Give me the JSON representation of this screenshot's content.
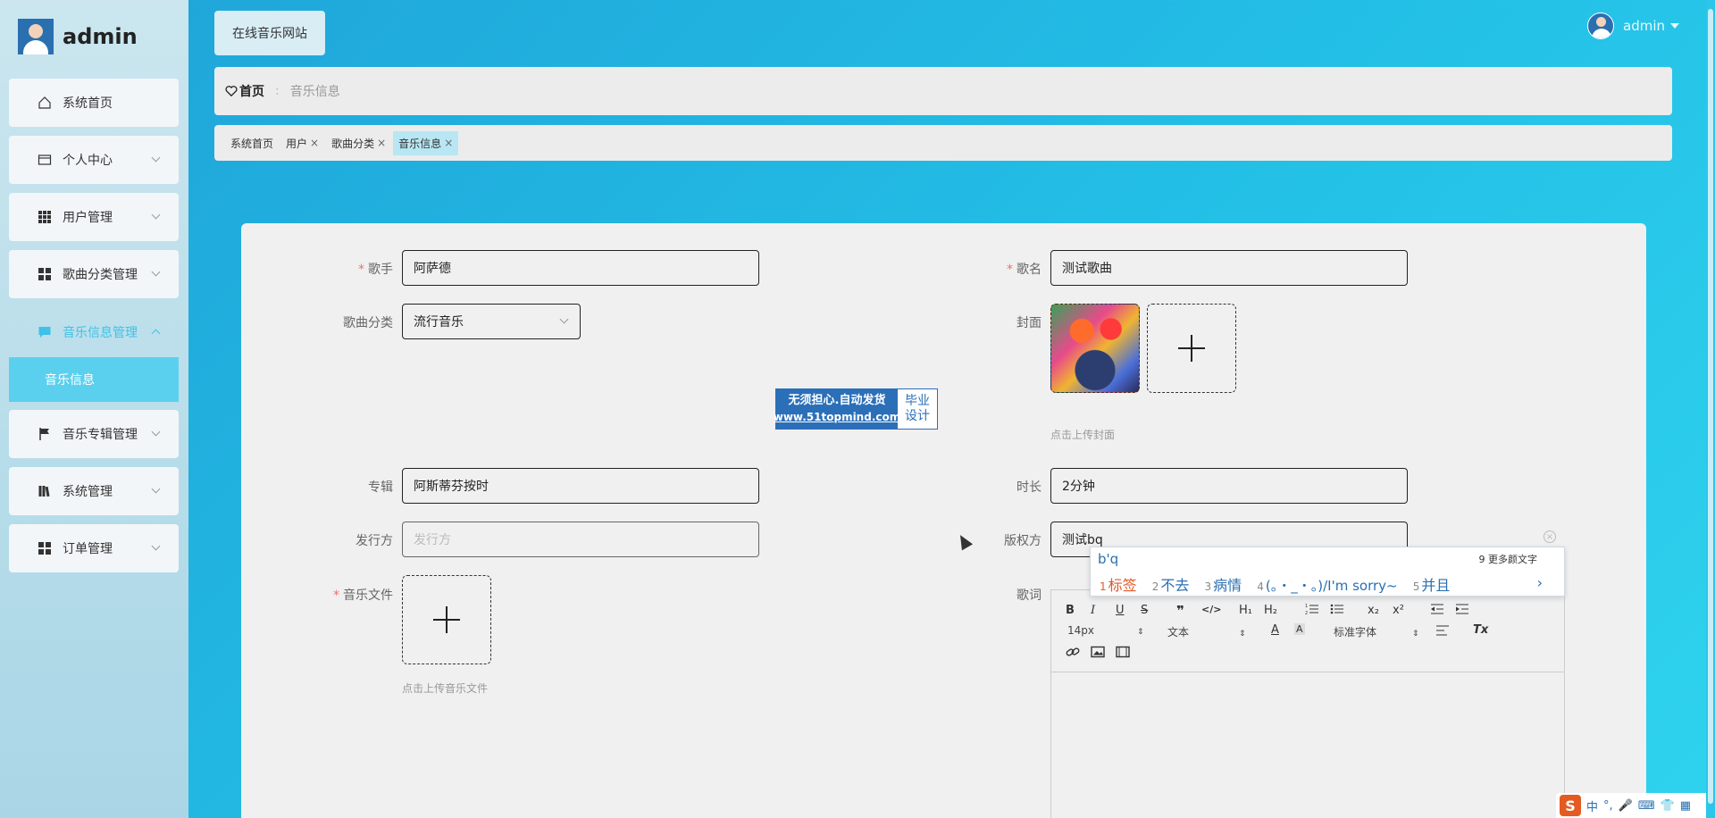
{
  "brand": {
    "name": "admin"
  },
  "sidebar": {
    "items": [
      {
        "label": "系统首页",
        "icon": "home-icon"
      },
      {
        "label": "个人中心",
        "icon": "card-icon"
      },
      {
        "label": "用户管理",
        "icon": "grid-icon"
      },
      {
        "label": "歌曲分类管理",
        "icon": "grid-icon"
      },
      {
        "label": "音乐信息管理",
        "icon": "chat-icon"
      },
      {
        "label": "音乐专辑管理",
        "icon": "flag-icon"
      },
      {
        "label": "系统管理",
        "icon": "book-icon"
      },
      {
        "label": "订单管理",
        "icon": "grid-icon"
      }
    ],
    "sub_item": "音乐信息"
  },
  "header": {
    "site_button": "在线音乐网站",
    "user": "admin"
  },
  "breadcrumb": {
    "home": "首页",
    "current": "音乐信息"
  },
  "tags": [
    {
      "label": "系统首页"
    },
    {
      "label": "用户"
    },
    {
      "label": "歌曲分类"
    },
    {
      "label": "音乐信息"
    }
  ],
  "form": {
    "singer_label": "歌手",
    "singer_value": "阿萨德",
    "song_label": "歌名",
    "song_value": "测试歌曲",
    "category_label": "歌曲分类",
    "category_value": "流行音乐",
    "cover_label": "封面",
    "cover_hint": "点击上传封面",
    "album_label": "专辑",
    "album_value": "阿斯蒂芬按时",
    "duration_label": "时长",
    "duration_value": "2分钟",
    "publisher_label": "发行方",
    "publisher_placeholder": "发行方",
    "copyright_label": "版权方",
    "copyright_value": "测试bq",
    "music_label": "音乐文件",
    "music_hint": "点击上传音乐文件",
    "lyrics_label": "歌词"
  },
  "watermark": {
    "line1": "无须担心.自动发货",
    "line2": "www.51topmind.com",
    "right1": "毕业",
    "right2": "设计"
  },
  "editor": {
    "font_size": "14px",
    "paragraph": "文本",
    "font_family": "标准字体",
    "buttons": [
      "B",
      "I",
      "U",
      "S",
      "❞",
      "</>",
      "H₁",
      "H₂",
      "x₂",
      "x²",
      "Tx"
    ]
  },
  "ime": {
    "input": "b'q",
    "more": "9 更多颜文字",
    "candidates": [
      {
        "n": "1",
        "text": "标签"
      },
      {
        "n": "2",
        "text": "不去"
      },
      {
        "n": "3",
        "text": "病情"
      },
      {
        "n": "4",
        "text": "(。・_・。)/I'm sorry~"
      },
      {
        "n": "5",
        "text": "并且"
      }
    ]
  },
  "tray": {
    "mode": "中",
    "punct": "°,"
  }
}
